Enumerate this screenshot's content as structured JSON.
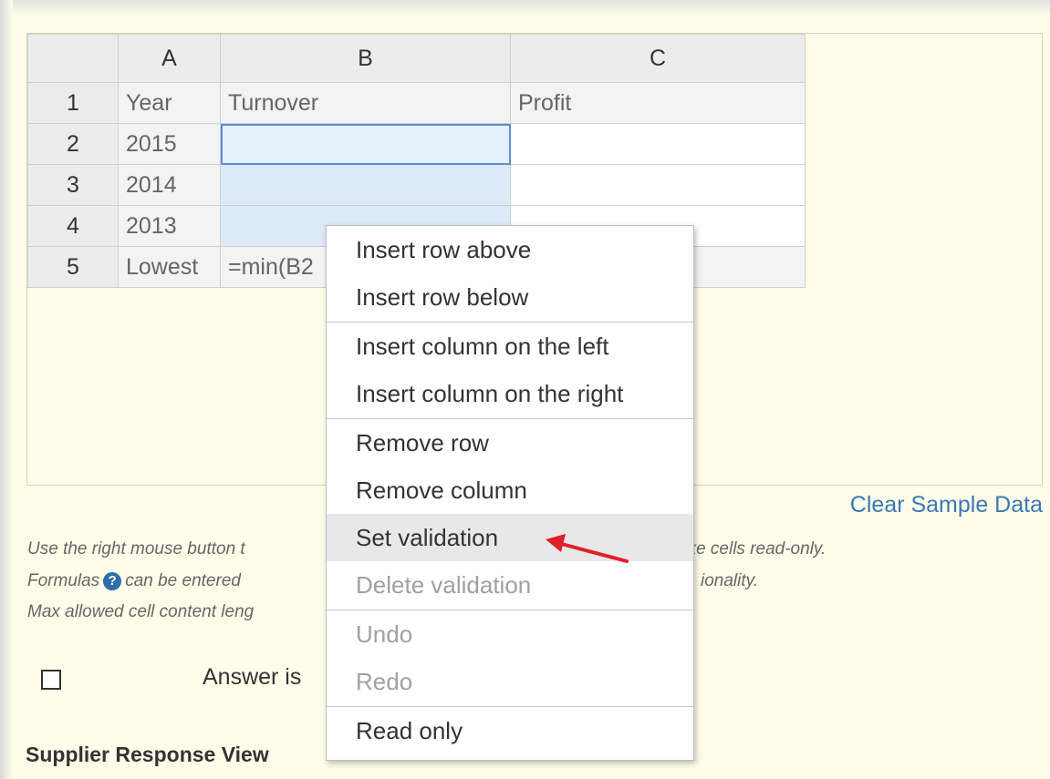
{
  "sheet": {
    "column_headers": [
      "A",
      "B",
      "C"
    ],
    "row_headers": [
      "1",
      "2",
      "3",
      "4",
      "5"
    ],
    "cells": {
      "a1": "Year",
      "b1": "Turnover",
      "c1": "Profit",
      "a2": "2015",
      "b2": "",
      "c2": "",
      "a3": "2014",
      "b3": "",
      "c3": "",
      "a4": "2013",
      "b4": "",
      "c4": "",
      "a5": "Lowest",
      "b5": "=min(B2"
    }
  },
  "clear_sample_data": "Clear Sample Data",
  "help": {
    "line1_left": "Use the right mouse button t",
    "line1_right": "ake cells read-only.",
    "line2_left_a": "Formulas",
    "line2_left_b": "can be entered",
    "line2_right": "ionality.",
    "line3_left": "Max allowed cell content leng"
  },
  "answer_label": "Answer is",
  "supplier_heading": "Supplier Response View",
  "context_menu": {
    "items": [
      "Insert row above",
      "Insert row below",
      "Insert column on the left",
      "Insert column on the right",
      "Remove row",
      "Remove column",
      "Set validation",
      "Delete validation",
      "Undo",
      "Redo",
      "Read only"
    ]
  },
  "colors": {
    "accent": "#3a79b4",
    "annotation_arrow": "#e0202a",
    "background": "#fffde9"
  }
}
